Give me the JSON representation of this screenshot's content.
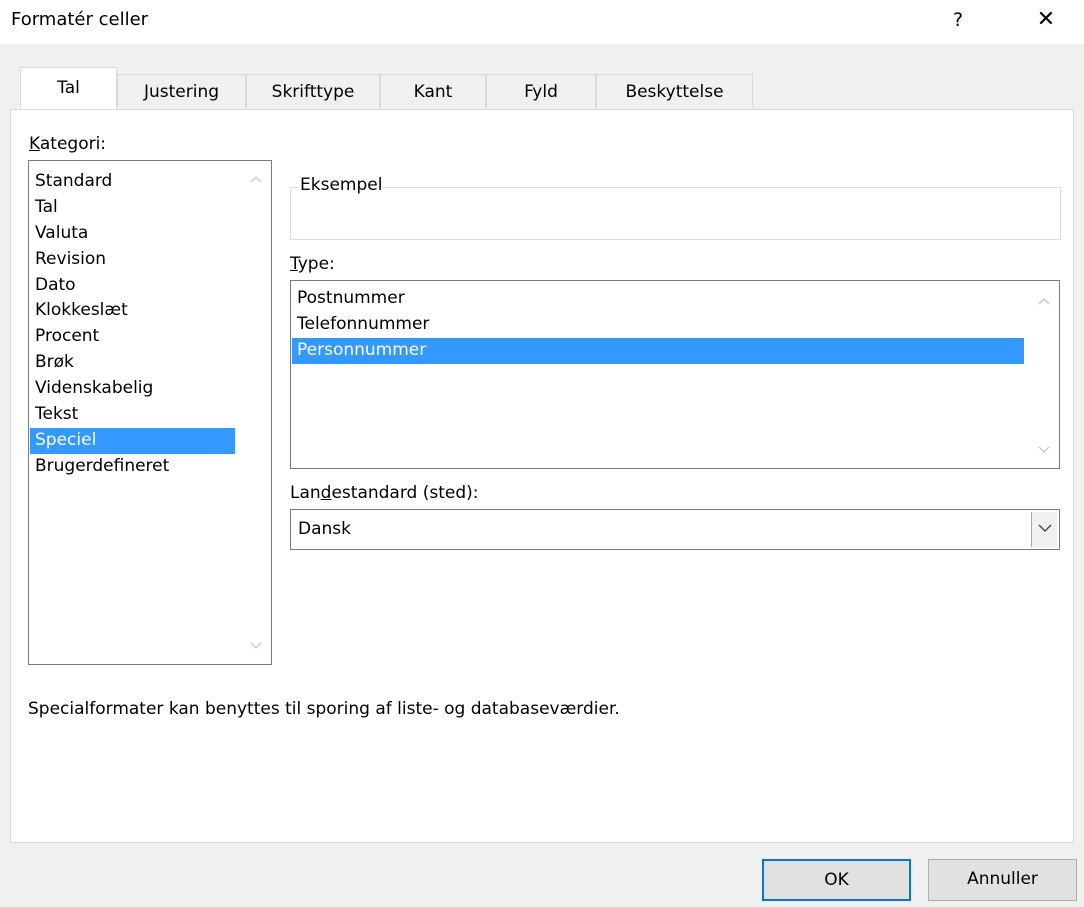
{
  "dialog": {
    "title": "Formatér celler",
    "help_label": "?",
    "close_label": "✕"
  },
  "tabs": [
    {
      "label": "Tal",
      "active": true
    },
    {
      "label": "Justering",
      "active": false
    },
    {
      "label": "Skrifttype",
      "active": false
    },
    {
      "label": "Kant",
      "active": false
    },
    {
      "label": "Fyld",
      "active": false
    },
    {
      "label": "Beskyttelse",
      "active": false
    }
  ],
  "category": {
    "label_mnemonic": "K",
    "label_rest": "ategori:",
    "items": [
      "Standard",
      "Tal",
      "Valuta",
      "Revision",
      "Dato",
      "Klokkeslæt",
      "Procent",
      "Brøk",
      "Videnskabelig",
      "Tekst",
      "Speciel",
      "Brugerdefineret"
    ],
    "selected": "Speciel"
  },
  "example": {
    "legend": "Eksempel",
    "value": ""
  },
  "type": {
    "label_mnemonic": "T",
    "label_rest": "ype:",
    "items": [
      "Postnummer",
      "Telefonnummer",
      "Personnummer"
    ],
    "selected": "Personnummer"
  },
  "locale": {
    "label_pre": "Lan",
    "label_mnemonic": "d",
    "label_rest": "estandard (sted):",
    "value": "Dansk"
  },
  "description": "Specialformater kan benyttes til sporing af liste- og databaseværdier.",
  "buttons": {
    "ok": "OK",
    "cancel": "Annuller"
  },
  "icons": {
    "scroll_up": "chevron-up-icon",
    "scroll_down": "chevron-down-icon",
    "dropdown": "chevron-down-icon"
  },
  "colors": {
    "selection": "#3399ff",
    "default_button_border": "#0078d7",
    "dialog_bg": "#f0f0f0"
  }
}
